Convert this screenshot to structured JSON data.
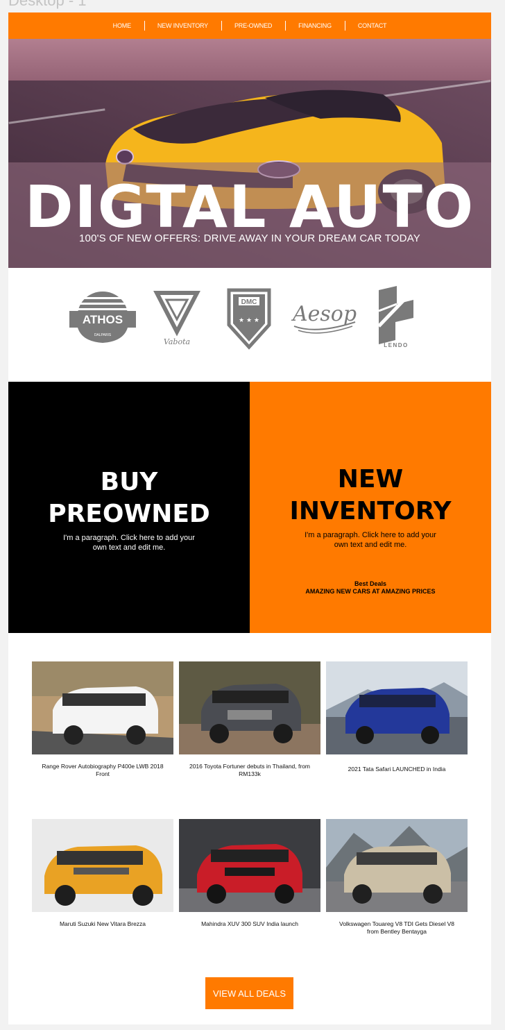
{
  "frame": {
    "label": "Desktop - 1"
  },
  "nav": {
    "items": [
      "HOME",
      "NEW INVENTORY",
      "PRE-OWNED",
      "FINANCING",
      "CONTACT"
    ]
  },
  "hero": {
    "title": "DIGTAL AUTO",
    "subtitle": "100'S OF NEW OFFERS: DRIVE AWAY IN YOUR DREAM CAR TODAY"
  },
  "brands": {
    "logos": [
      {
        "name": "ATHOS",
        "sub": "DALPARIS"
      },
      {
        "name": "Vabota"
      },
      {
        "name": "DMC"
      },
      {
        "name": "Aesop"
      },
      {
        "name": "LENDO"
      }
    ]
  },
  "promo": {
    "left": {
      "title": "BUY\nPREOWNED",
      "text": "I'm a paragraph. Click here to add your own text and edit me."
    },
    "right": {
      "title": "NEW\nINVENTORY",
      "text": "I'm a paragraph. Click here to add your own text and edit me.",
      "deals_heading": "Best Deals",
      "deals_text": "AMAZING NEW CARS AT AMAZING PRICES"
    }
  },
  "gallery": {
    "cards": [
      {
        "caption": "Range Rover Autobiography P400e LWB 2018 Front"
      },
      {
        "caption": "2016 Toyota Fortuner debuts in Thailand, from RM133k"
      },
      {
        "caption": "2021 Tata Safari LAUNCHED in India"
      },
      {
        "caption": "Maruti Suzuki New Vitara Brezza"
      },
      {
        "caption": "Mahindra XUV 300 SUV India launch"
      },
      {
        "caption": "Volkswagen Touareg V8 TDI Gets Diesel V8 from Bentley Bentayga"
      }
    ]
  },
  "cta": {
    "label": "VIEW ALL DEALS"
  },
  "colors": {
    "accent": "#ff7a00",
    "dark": "#000000"
  }
}
